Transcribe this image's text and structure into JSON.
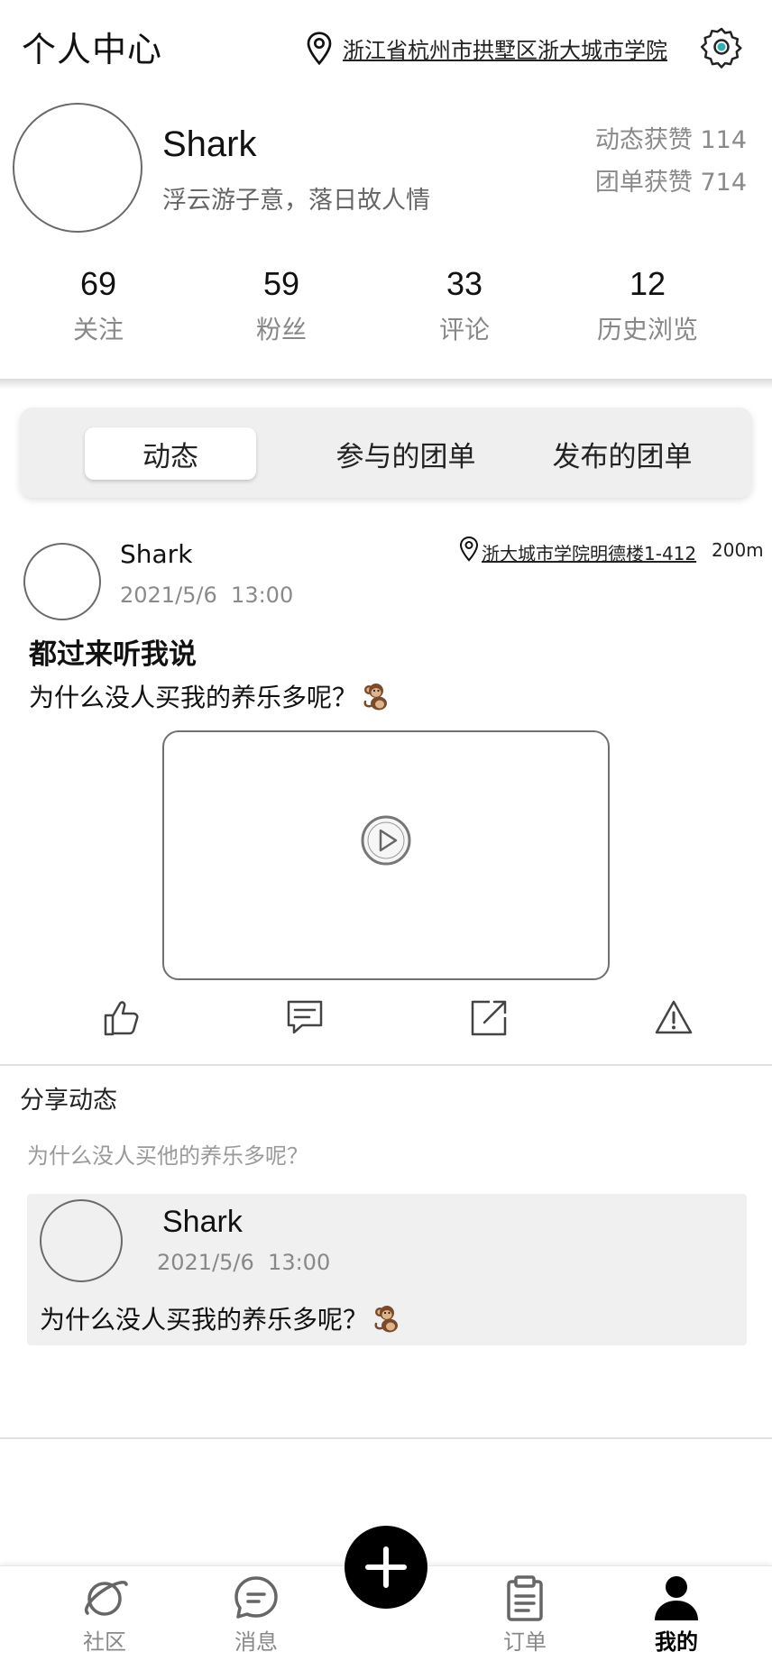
{
  "header": {
    "title": "个人中心",
    "location": "浙江省杭州市拱墅区浙大城市学院"
  },
  "profile": {
    "name": "Shark",
    "bio": "浮云游子意，落日故人情",
    "post_likes": "动态获赞 114",
    "group_likes": "团单获赞 714",
    "stats": [
      {
        "value": "69",
        "label": "关注"
      },
      {
        "value": "59",
        "label": "粉丝"
      },
      {
        "value": "33",
        "label": "评论"
      },
      {
        "value": "12",
        "label": "历史浏览"
      }
    ]
  },
  "tabs": [
    {
      "label": "动态",
      "active": true
    },
    {
      "label": "参与的团单",
      "active": false
    },
    {
      "label": "发布的团单",
      "active": false
    }
  ],
  "post": {
    "author": "Shark",
    "time": "2021/5/6  13:00",
    "location": "浙大城市学院明德楼1-412",
    "distance": "200m",
    "title": "都过来听我说",
    "text": "为什么没人买我的养乐多呢？",
    "emoji_icon": "monkey-icon"
  },
  "share": {
    "title": "分享动态",
    "comment": "为什么没人买他的养乐多呢？",
    "author": "Shark",
    "time": "2021/5/6  13:00",
    "text": "为什么没人买我的养乐多呢？"
  },
  "nav": {
    "items": [
      {
        "label": "社区",
        "icon": "planet-icon"
      },
      {
        "label": "消息",
        "icon": "message-icon"
      },
      {
        "label": "订单",
        "icon": "clipboard-icon"
      },
      {
        "label": "我的",
        "icon": "user-icon",
        "active": true
      }
    ]
  },
  "colors": {
    "accent": "#2bb3b3",
    "muted": "#8a8a8a",
    "card_bg": "#f0f0f0"
  }
}
